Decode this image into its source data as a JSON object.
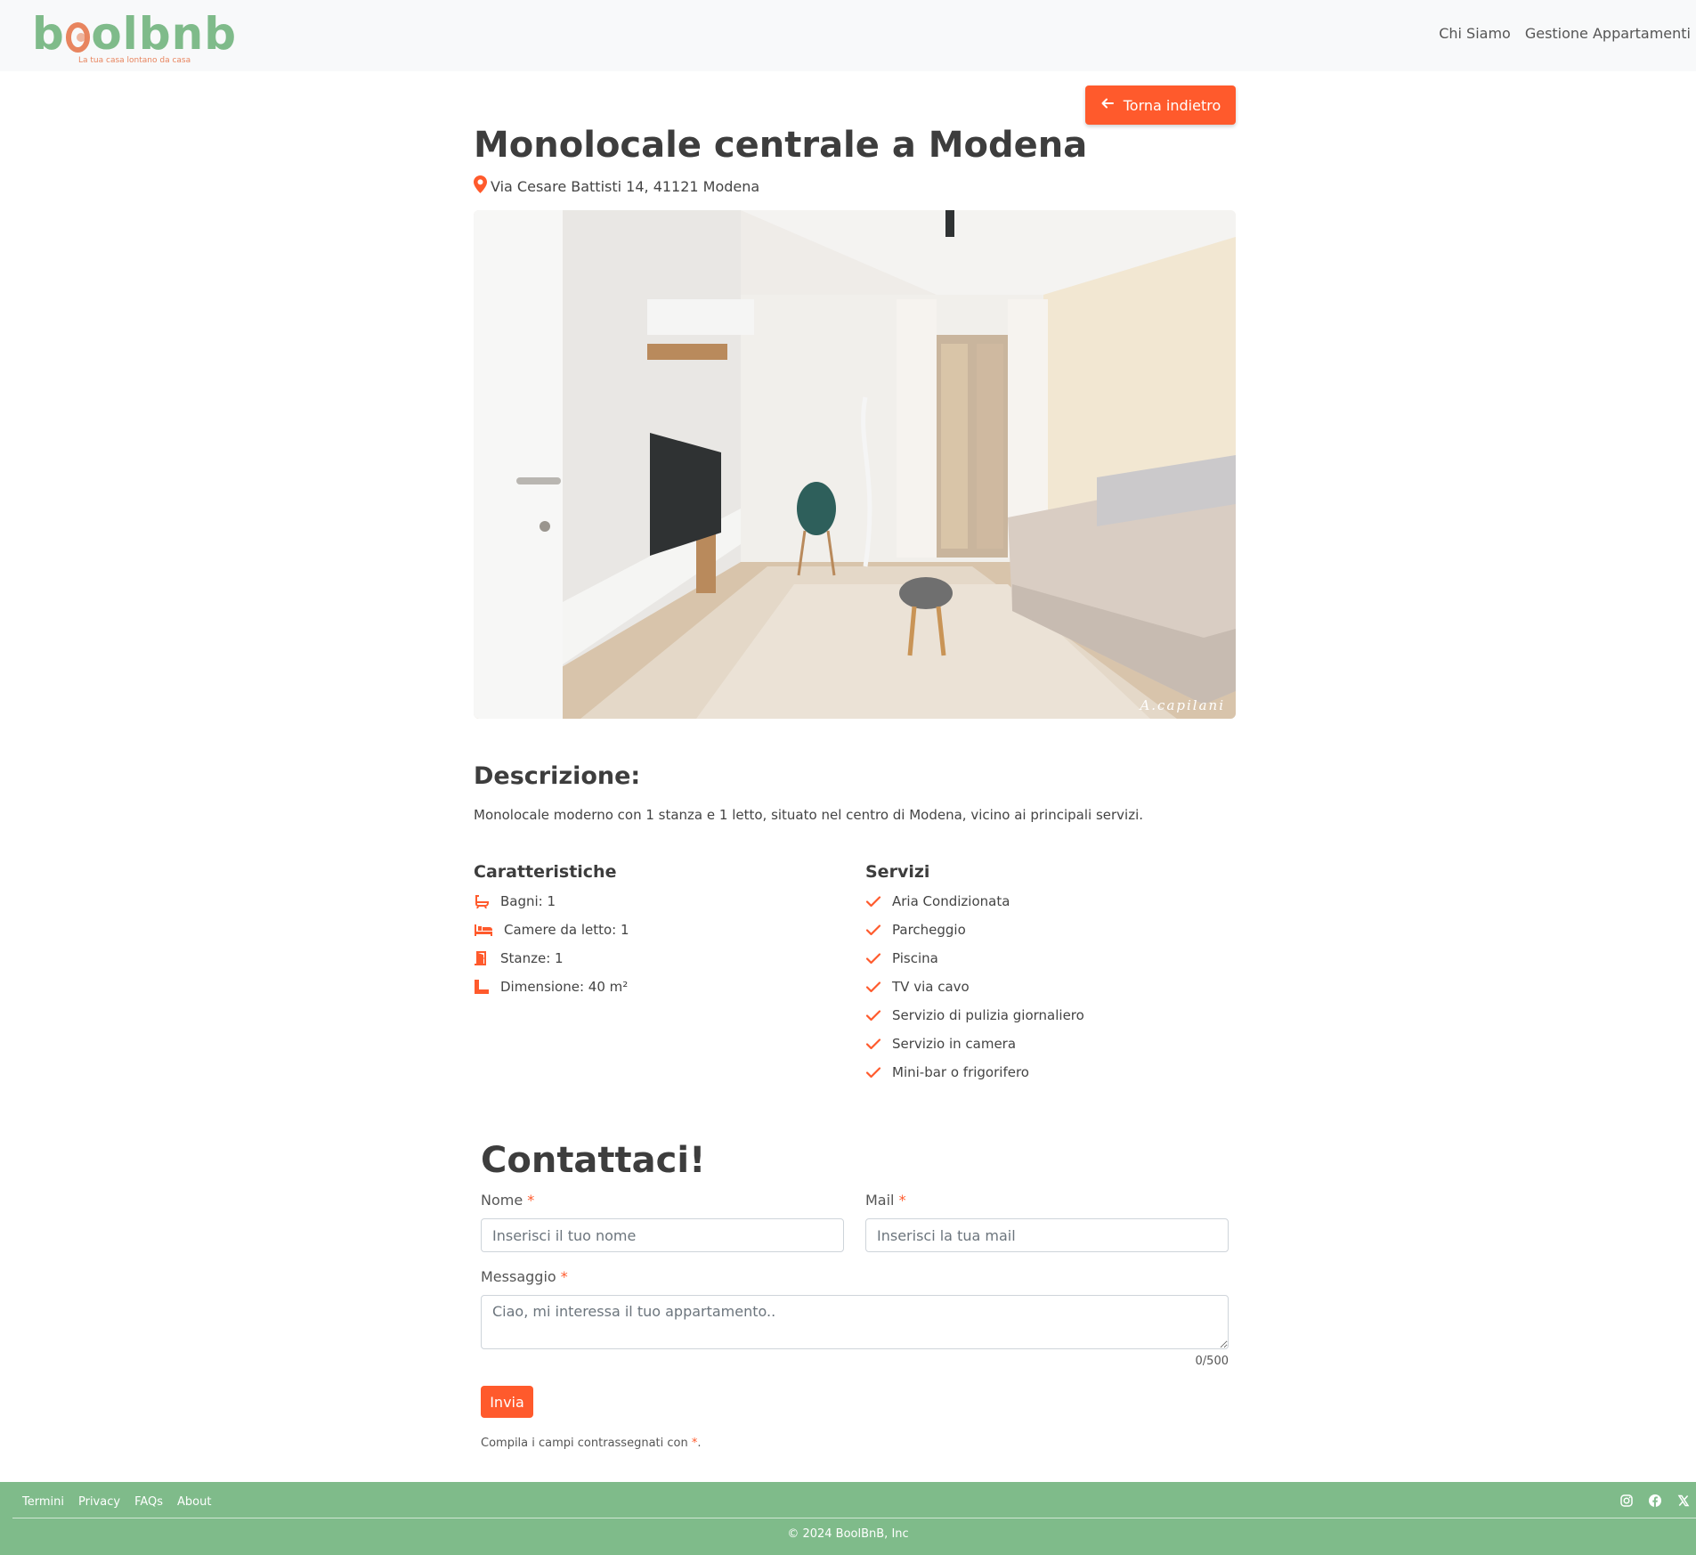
{
  "navbar": {
    "logo_text_pre": "b",
    "logo_text_post": "olbnb",
    "logo_tagline": "La tua casa lontano da casa",
    "links": [
      "Chi Siamo",
      "Gestione Appartamenti"
    ]
  },
  "back_button": {
    "label": "Torna indietro",
    "icon": "arrow-left-icon"
  },
  "apartment": {
    "title": "Monolocale centrale a Modena",
    "address": "Via Cesare Battisti 14, 41121 Modena",
    "photo_signature": "A.capilani"
  },
  "description": {
    "heading": "Descrizione:",
    "text": "Monolocale moderno con 1 stanza e 1 letto, situato nel centro di Modena, vicino ai principali servizi."
  },
  "features": {
    "heading": "Caratteristiche",
    "items": [
      {
        "icon": "bath-icon",
        "label": "Bagni: 1"
      },
      {
        "icon": "bed-icon",
        "label": "Camere da letto: 1"
      },
      {
        "icon": "door-icon",
        "label": "Stanze: 1"
      },
      {
        "icon": "ruler-icon",
        "label": "Dimensione: 40 m²"
      }
    ]
  },
  "services": {
    "heading": "Servizi",
    "items": [
      "Aria Condizionata",
      "Parcheggio",
      "Piscina",
      "TV via cavo",
      "Servizio di pulizia giornaliero",
      "Servizio in camera",
      "Mini-bar o frigorifero"
    ]
  },
  "contact": {
    "heading": "Contattaci!",
    "name_label": "Nome",
    "name_placeholder": "Inserisci il tuo nome",
    "mail_label": "Mail",
    "mail_placeholder": "Inserisci la tua mail",
    "message_label": "Messaggio",
    "message_placeholder": "Ciao, mi interessa il tuo appartamento..",
    "required_mark": "*",
    "counter": "0/500",
    "submit_label": "Invia",
    "note_pre": "Compila i campi contrassegnati con ",
    "note_post": "."
  },
  "footer": {
    "links": [
      "Termini",
      "Privacy",
      "FAQs",
      "About"
    ],
    "social": [
      "instagram-icon",
      "facebook-icon",
      "x-icon"
    ],
    "copyright": "© 2024 BoolBnB, Inc"
  },
  "colors": {
    "accent": "#ff5a2c",
    "brand_green": "#7fbb8a",
    "logo_orange": "#e8855f"
  }
}
